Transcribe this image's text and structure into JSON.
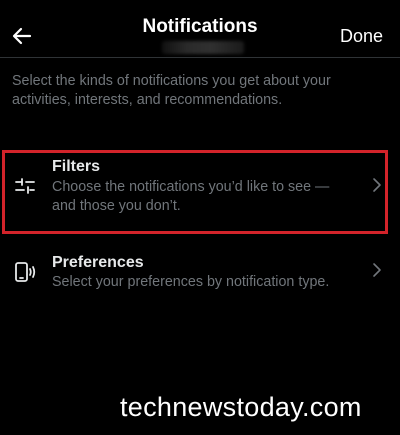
{
  "header": {
    "title": "Notifications",
    "done_label": "Done"
  },
  "intro": {
    "text": "Select the kinds of notifications you get about your activities, interests, and recommendations."
  },
  "items": [
    {
      "title": "Filters",
      "description": "Choose the notifications you’d like to see — and those you don’t.",
      "icon": "sliders-icon",
      "highlighted": true
    },
    {
      "title": "Preferences",
      "description": "Select your preferences by notification type.",
      "icon": "phone-vibrate-icon",
      "highlighted": false
    }
  ],
  "watermark": {
    "text": "technewstoday.com"
  },
  "colors": {
    "background": "#000000",
    "text_primary": "#e7e9ea",
    "text_secondary": "#71767b",
    "highlight_border": "#d2232a"
  }
}
